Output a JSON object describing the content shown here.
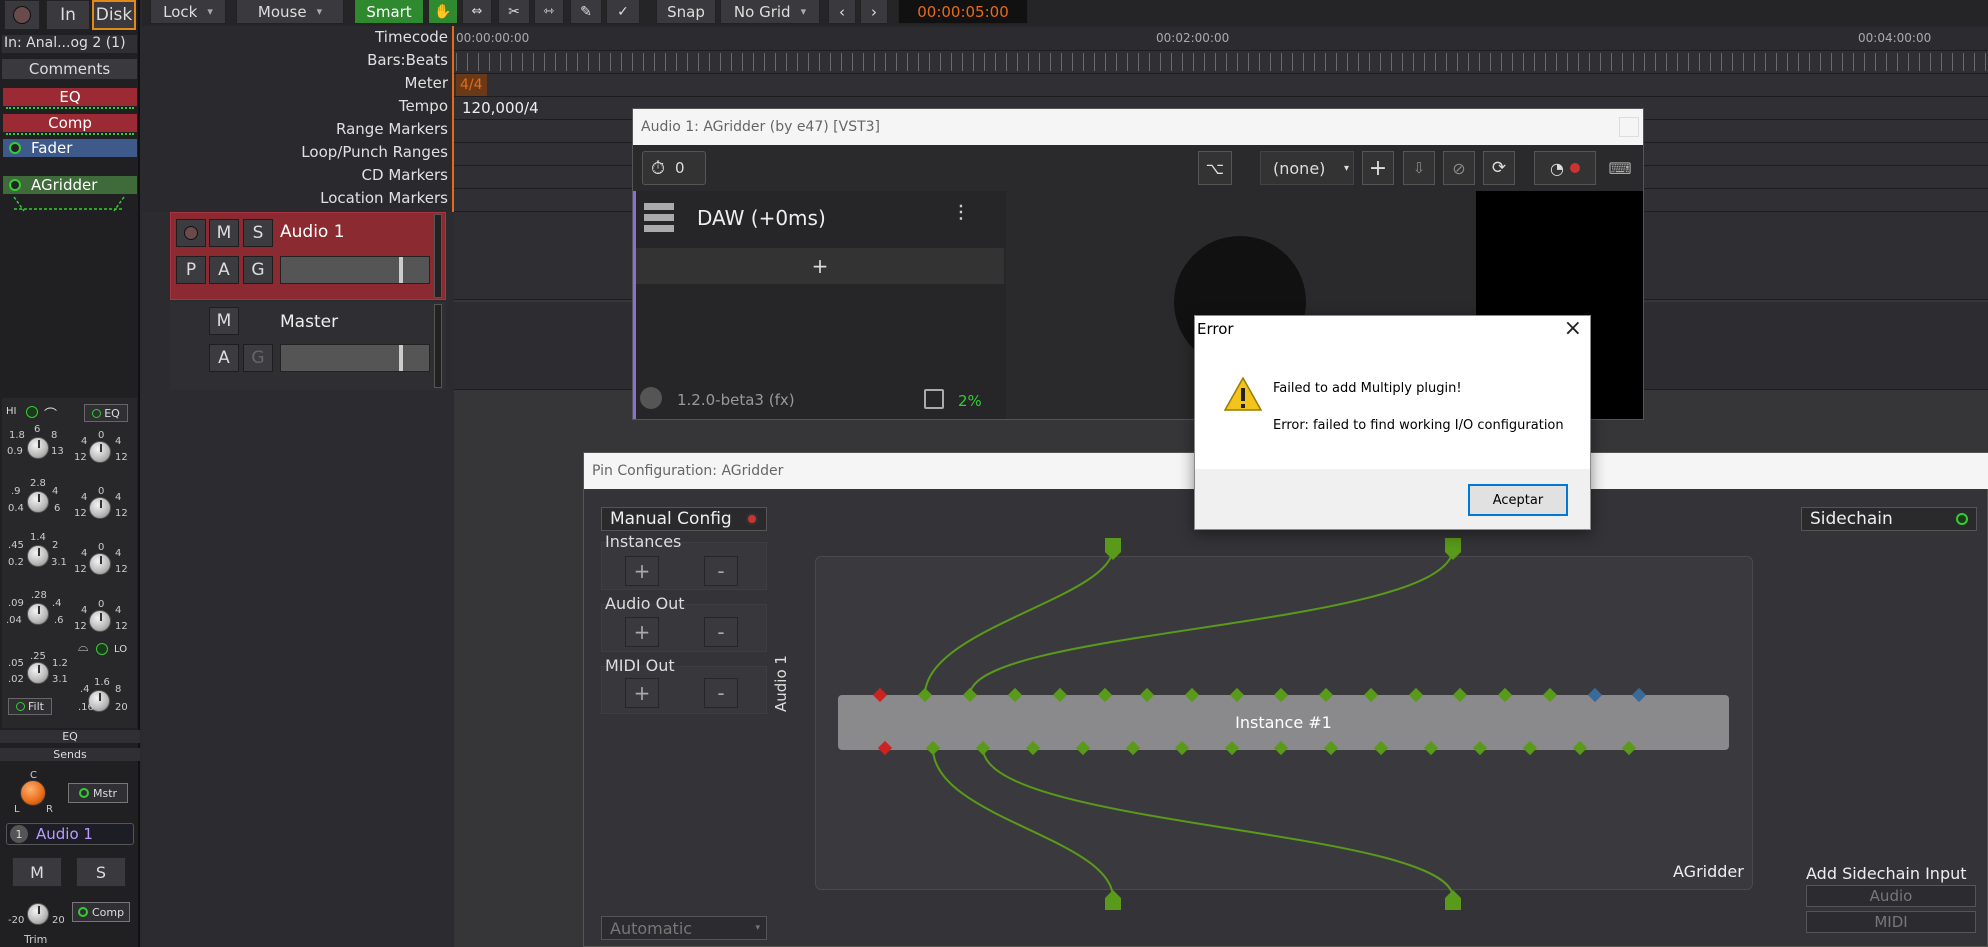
{
  "toolbar": {
    "in_label": "In",
    "disk_label": "Disk",
    "lock_label": "Lock",
    "mouse_label": "Mouse",
    "smart_label": "Smart",
    "snap_label": "Snap",
    "grid_label": "No Grid",
    "clock": "00:00:05:00"
  },
  "strip": {
    "input": "In: Anal...og 2 (1)",
    "comments": "Comments",
    "plugins": [
      "EQ",
      "Comp",
      "Fader",
      "AGridder"
    ],
    "eq_label": "EQ",
    "hi_label": "HI",
    "lo_label": "LO",
    "filt_label": "Filt",
    "eq_section_label": "EQ",
    "sends_label": "Sends",
    "mstr_label": "Mstr",
    "track_number": "1",
    "track_name": "Audio 1",
    "mute": "M",
    "solo": "S",
    "comp_label": "Comp",
    "trim_label": "Trim",
    "knob_labels": {
      "k1": [
        "1.8",
        "6",
        "8",
        "0.9",
        "13"
      ],
      "k2": [
        ".9",
        "2.8",
        "4",
        "0.4",
        "6"
      ],
      "k3": [
        ".45",
        "1.4",
        "2",
        "0.2",
        "3.1"
      ],
      "k4": [
        ".09",
        ".28",
        ".4",
        ".04",
        ".6"
      ],
      "k5": [
        ".05",
        ".25",
        "1.2",
        ".02",
        "3.1"
      ],
      "k6": [
        ".4",
        "1.6",
        "8",
        ".16",
        "20"
      ],
      "gain": [
        "4",
        "0",
        "4",
        "12",
        "12"
      ],
      "trim": [
        "-20",
        "20"
      ],
      "pan": [
        "C",
        "L",
        "R"
      ]
    }
  },
  "rulers": {
    "labels": [
      "Timecode",
      "Bars:Beats",
      "Meter",
      "Tempo",
      "Range Markers",
      "Loop/Punch Ranges",
      "CD Markers",
      "Location Markers"
    ],
    "timecodes": [
      "00:00:00:00",
      "00:02:00:00",
      "00:04:00:00"
    ],
    "meter": "4/4",
    "tempo": "120,000/4"
  },
  "tracks": [
    {
      "name": "Audio 1",
      "buttons": [
        "M",
        "S",
        "P",
        "A",
        "G"
      ]
    },
    {
      "name": "Master",
      "buttons": [
        "M",
        "A",
        "G"
      ]
    }
  ],
  "plugin_window": {
    "title": "Audio 1: AGridder (by e47) [VST3]",
    "counter": "0",
    "preset": "(none)",
    "daw_label": "DAW (+0ms)",
    "add": "+",
    "version": "1.2.0-beta3 (fx)",
    "cpu": "2%"
  },
  "pin_config": {
    "title": "Pin Configuration: AGridder",
    "manual_config": "Manual Config",
    "instances": "Instances",
    "audio_out": "Audio Out",
    "midi_out": "MIDI Out",
    "plus": "+",
    "minus": "-",
    "track_label": "Audio 1",
    "instance_label": "Instance #1",
    "plugin_label": "AGridder",
    "mode": "Automatic",
    "sidechain": "Sidechain",
    "add_sidechain": "Add Sidechain Input",
    "audio": "Audio",
    "midi": "MIDI"
  },
  "error_dialog": {
    "title": "Error",
    "message": "Failed to add Multiply plugin!",
    "detail": "Error: failed to find working I/O configuration",
    "ok": "Aceptar"
  },
  "colors": {
    "eq": "#9b2a34",
    "comp": "#9b2a34",
    "fader": "#3e5a8a",
    "agridder": "#3f6a3a",
    "pin_green": "#5a9a1a",
    "smart_green": "#2f8a2f",
    "clock_orange": "#e86a17"
  }
}
